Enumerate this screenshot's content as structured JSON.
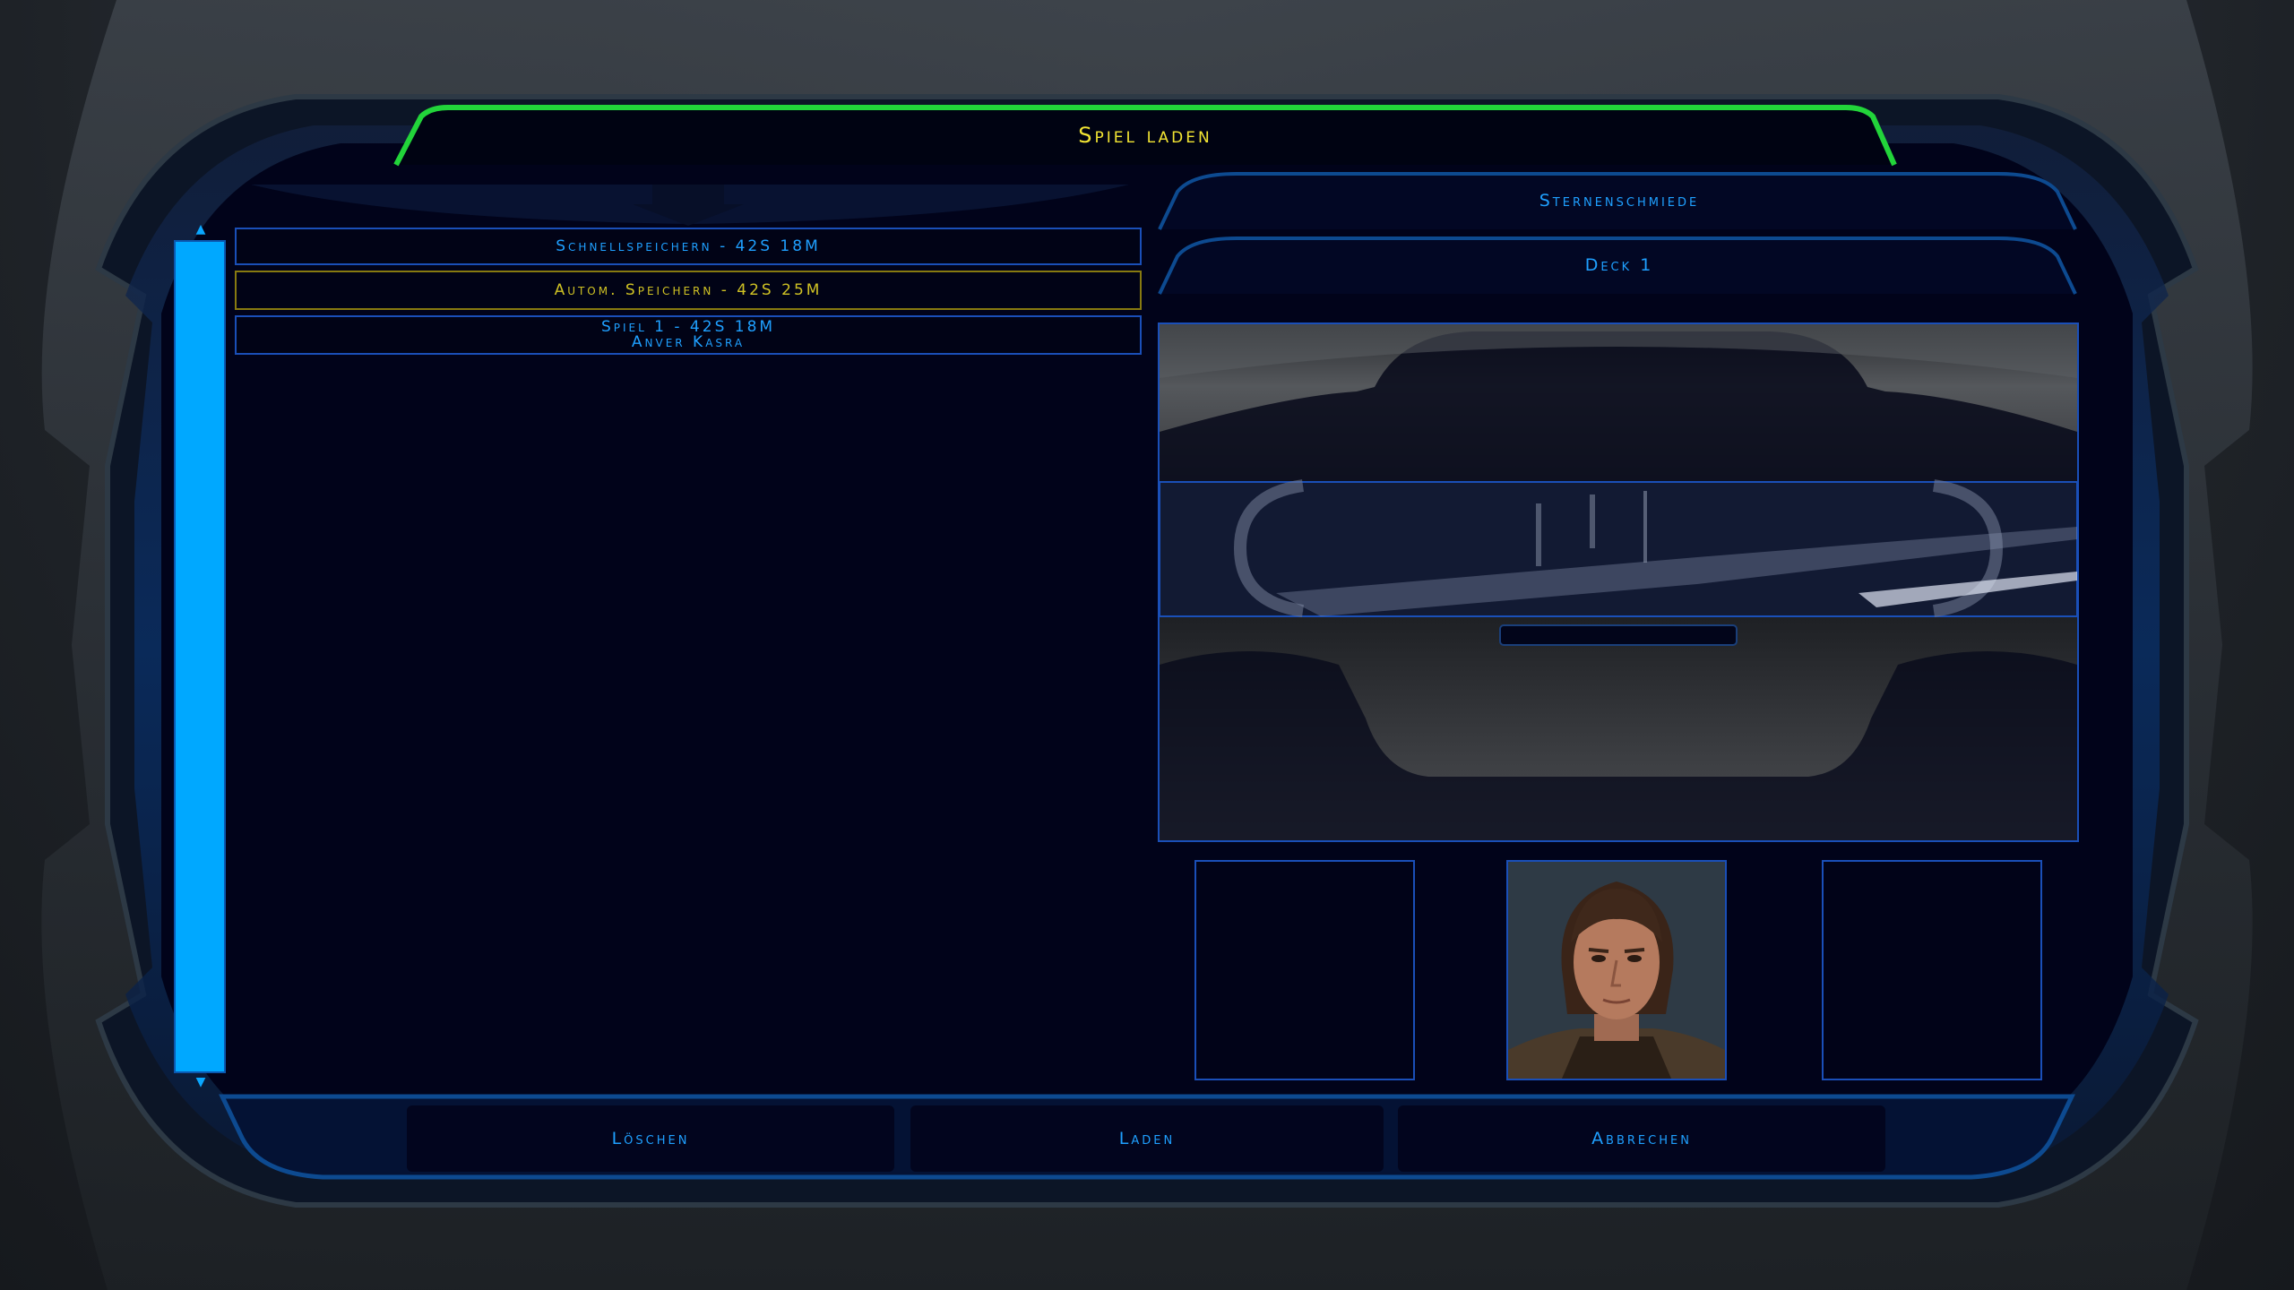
{
  "title": "Spiel laden",
  "module_name": "Sternenschmiede",
  "area_name": "Deck 1",
  "save_list": [
    {
      "line1": "Schnellspeichern - 42S 18M",
      "line2": "",
      "selected": false
    },
    {
      "line1": "Autom. Speichern - 42S 25M",
      "line2": "",
      "selected": true
    },
    {
      "line1": "Spiel 1 - 42S 18M",
      "line2": "Anver Kasra",
      "selected": false
    }
  ],
  "buttons": {
    "delete": "Löschen",
    "load": "Laden",
    "cancel": "Abbrechen"
  },
  "scroll": {
    "up_icon": "▲",
    "down_icon": "▼",
    "position": 0.0
  },
  "colors": {
    "title_text": "#f2e533",
    "title_border": "#22d43a",
    "accent_blue": "#1fa0ff",
    "scrollbar": "#00a8ff",
    "selected_text": "#cfc224",
    "panel_bg": "#01031a"
  },
  "icons": {
    "portrait_center": "character-face-portrait",
    "preview": "area-screenshot"
  }
}
